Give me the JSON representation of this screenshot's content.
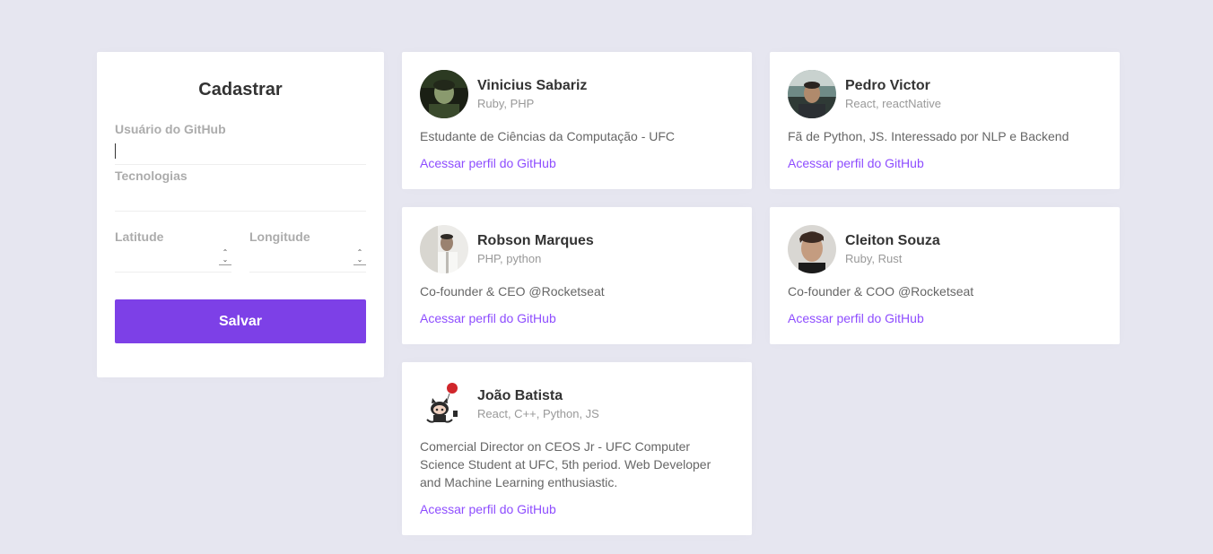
{
  "form": {
    "title": "Cadastrar",
    "github_user_label": "Usuário do GitHub",
    "github_user_value": "",
    "techs_label": "Tecnologias",
    "techs_value": "",
    "latitude_label": "Latitude",
    "latitude_value": "",
    "longitude_label": "Longitude",
    "longitude_value": "",
    "submit_label": "Salvar"
  },
  "colors": {
    "background": "#e6e6f0",
    "accent": "#7d40e7",
    "link": "#8e4dff"
  },
  "link_label": "Acessar perfil do GitHub",
  "devs": [
    {
      "name": "Vinicius Sabariz",
      "techs": "Ruby, PHP",
      "bio": "Estudante de Ciências da Computação - UFC",
      "avatar": "photo-avatar"
    },
    {
      "name": "Pedro Victor",
      "techs": "React, reactNative",
      "bio": "Fã de Python, JS. Interessado por NLP e Backend",
      "avatar": "photo-avatar"
    },
    {
      "name": "Robson Marques",
      "techs": "PHP, python",
      "bio": "Co-founder & CEO @Rocketseat",
      "avatar": "photo-avatar"
    },
    {
      "name": "Cleiton Souza",
      "techs": "Ruby, Rust",
      "bio": "Co-founder & COO @Rocketseat",
      "avatar": "photo-avatar"
    },
    {
      "name": "João Batista",
      "techs": "React, C++, Python, JS",
      "bio": "Comercial Director on CEOS Jr - UFC Computer Science Student at UFC, 5th period. Web Developer and Machine Learning enthusiastic.",
      "avatar": "octocat-avatar"
    }
  ]
}
